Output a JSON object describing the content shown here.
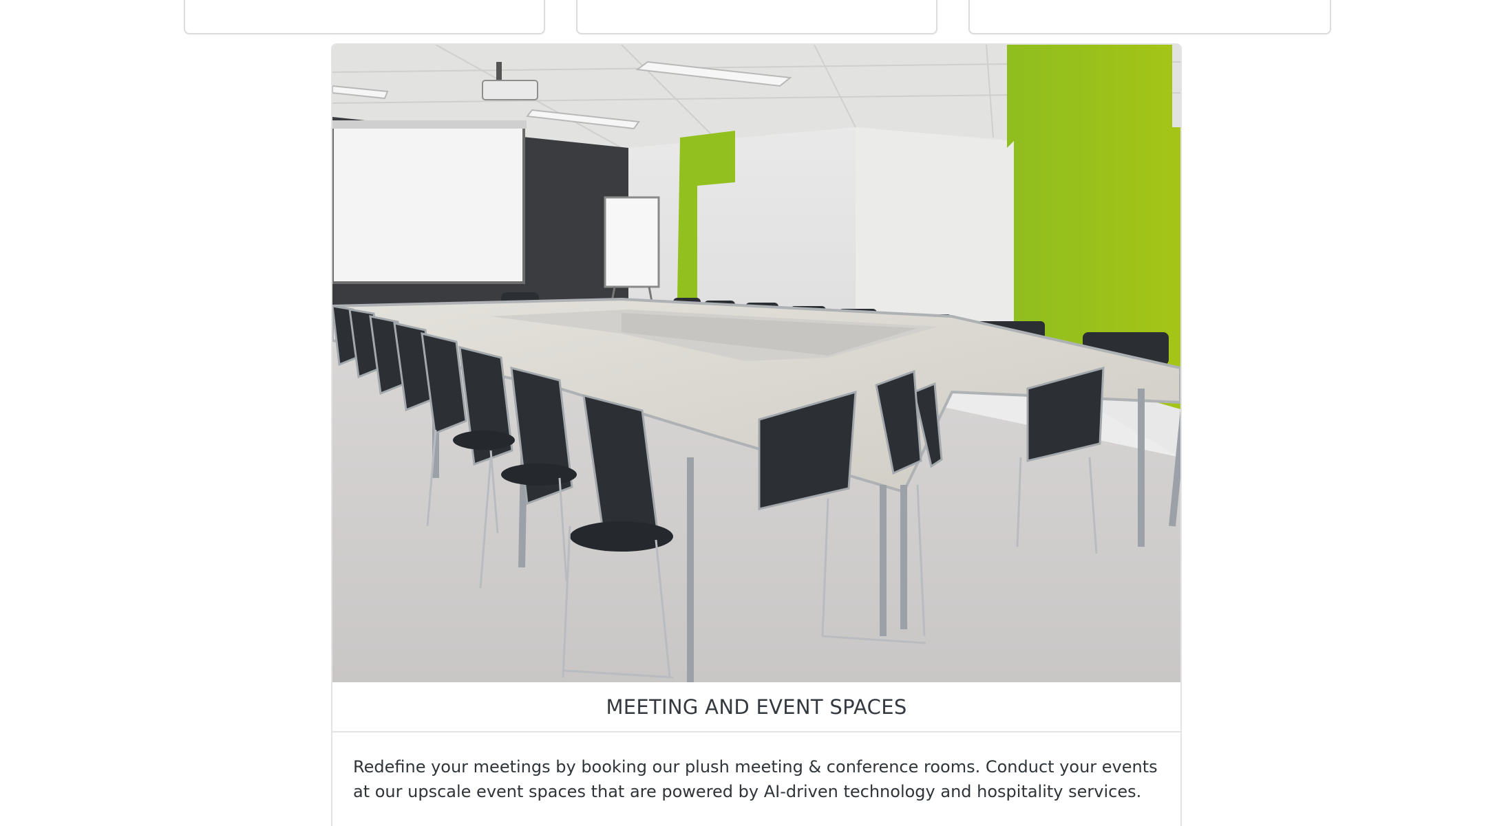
{
  "feature": {
    "image_alt": "Meeting room with U-shaped tables, black chairs, projector screen and green accent walls",
    "title": "MEETING AND EVENT SPACES",
    "description": "Redefine your meetings by booking our plush meeting & conference rooms. Conduct your events at our upscale event spaces that are powered by AI-driven technology and hospitality services."
  },
  "colors": {
    "accent_green": "#9bc41a",
    "chair_black": "#2b2e33",
    "table_top": "#d8d6cf",
    "border": "#e3e3e3"
  }
}
